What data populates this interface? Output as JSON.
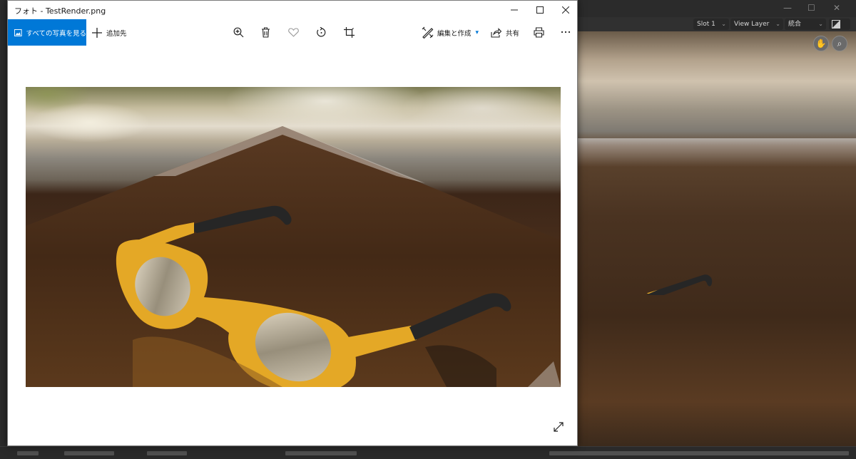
{
  "photos": {
    "title": "フォト - TestRender.png",
    "toolbar": {
      "all_photos_label": "すべての写真を見る",
      "add_to_label": "追加先",
      "edit_create_label": "編集と作成",
      "share_label": "共有"
    },
    "icons": [
      "zoom-in-icon",
      "delete-icon",
      "heart-icon",
      "rotate-icon",
      "crop-icon",
      "edit-create-icon",
      "share-icon",
      "print-icon",
      "more-icon",
      "expand-icon"
    ],
    "accent_color": "#0078d7"
  },
  "blender": {
    "header": {
      "slot": "Slot 1",
      "view_layer": "View Layer",
      "pass": "統合"
    },
    "icons": [
      "hand-pan-icon",
      "zoom-magnifier-icon",
      "display-mode-icon"
    ]
  }
}
